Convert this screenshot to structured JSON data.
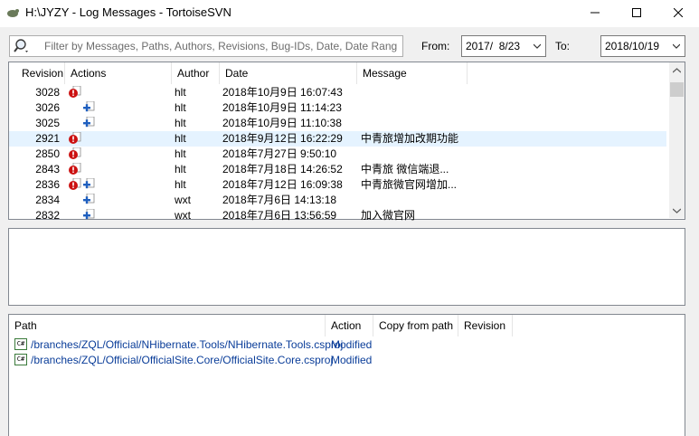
{
  "window": {
    "title": "H:\\JYZY - Log Messages - TortoiseSVN",
    "minimize": "—",
    "maximize": "☐",
    "close": "✕"
  },
  "filter": {
    "placeholder": "Filter by Messages, Paths, Authors, Revisions, Bug-IDs, Date, Date Range",
    "from_label": "From:",
    "from_value": "2017/  8/23",
    "to_label": "To:",
    "to_value": "2018/10/19"
  },
  "log": {
    "columns": [
      "Revision",
      "Actions",
      "Author",
      "Date",
      "Message"
    ],
    "rows": [
      {
        "revision": "3028",
        "actions": [
          "error"
        ],
        "author": "hlt",
        "date": "2018年10月9日 16:07:43",
        "message": ""
      },
      {
        "revision": "3026",
        "actions": [
          "modify"
        ],
        "author": "hlt",
        "date": "2018年10月9日 11:14:23",
        "message": ""
      },
      {
        "revision": "3025",
        "actions": [
          "modify"
        ],
        "author": "hlt",
        "date": "2018年10月9日 11:10:38",
        "message": ""
      },
      {
        "revision": "2921",
        "actions": [
          "error"
        ],
        "author": "hlt",
        "date": "2018年9月12日 16:22:29",
        "message": "中青旅增加改期功能"
      },
      {
        "revision": "2850",
        "actions": [
          "error"
        ],
        "author": "hlt",
        "date": "2018年7月27日 9:50:10",
        "message": ""
      },
      {
        "revision": "2843",
        "actions": [
          "error"
        ],
        "author": "hlt",
        "date": "2018年7月18日 14:26:52",
        "message": "中青旅 微信端退..."
      },
      {
        "revision": "2836",
        "actions": [
          "error",
          "modify"
        ],
        "author": "hlt",
        "date": "2018年7月12日 16:09:38",
        "message": "中青旅微官网增加..."
      },
      {
        "revision": "2834",
        "actions": [
          "modify"
        ],
        "author": "wxt",
        "date": "2018年7月6日 14:13:18",
        "message": ""
      },
      {
        "revision": "2832",
        "actions": [
          "modify"
        ],
        "author": "wxt",
        "date": "2018年7月6日 13:56:59",
        "message": "加入微官网"
      }
    ],
    "selected_revision": "2921"
  },
  "message_panel": {
    "text": ""
  },
  "paths": {
    "columns": [
      "Path",
      "Action",
      "Copy from path",
      "Revision"
    ],
    "rows": [
      {
        "icon": "C#",
        "path": "/branches/ZQL/Official/NHibernate.Tools/NHibernate.Tools.csproj",
        "action": "Modified"
      },
      {
        "icon": "C#",
        "path": "/branches/ZQL/Official/OfficialSite.Core/OfficialSite.Core.csproj",
        "action": "Modified"
      }
    ]
  },
  "colors": {
    "selected_row": "#e5f3ff",
    "path_link": "#0a3d99",
    "error_icon": "#cc1111",
    "modify_icon": "#1f5fbf"
  }
}
